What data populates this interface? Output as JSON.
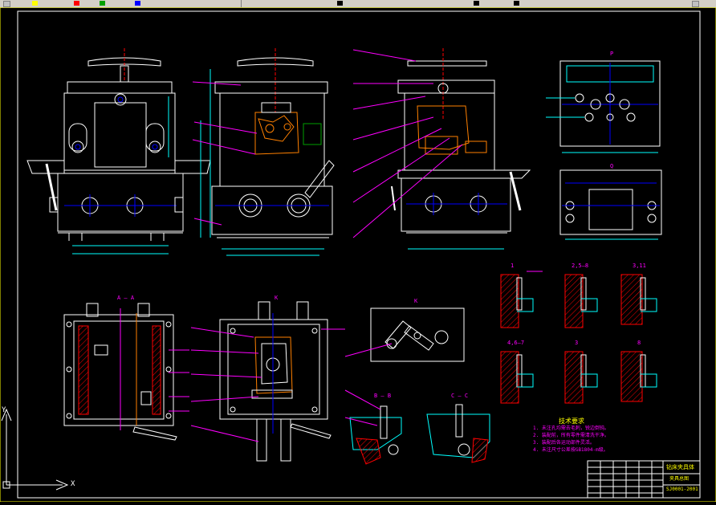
{
  "colors": {
    "background": "#000000",
    "frame": "#ffffff",
    "leader": "#ff00ff",
    "dim": "#00ffff",
    "part": "#ff8000",
    "toolbar": "#d4d0c8",
    "hatch": "#ff0000"
  },
  "views": {
    "p": "P",
    "q": "Q",
    "k": "K",
    "aa": "A — A",
    "k2": "K",
    "bb": "B — B",
    "cc": "C — C"
  },
  "sections": [
    "1",
    "2,5—8",
    "3,11",
    "4,6—7",
    "3",
    "8"
  ],
  "technical_requirements": {
    "title": "技术要求",
    "items": [
      "1. 未注孔均需去毛刺，锐边倒钝。",
      "2. 装配前，所有零件需清洗干净。",
      "3. 装配后各运动部件灵活。",
      "4. 未注尺寸公差按GB1804-m级。"
    ]
  },
  "title_block": {
    "title": "钻床夹具体",
    "subtitle": "夹具总图",
    "code": "SJ0001-2001"
  },
  "ucs": {
    "x": "X",
    "y": "Y"
  }
}
